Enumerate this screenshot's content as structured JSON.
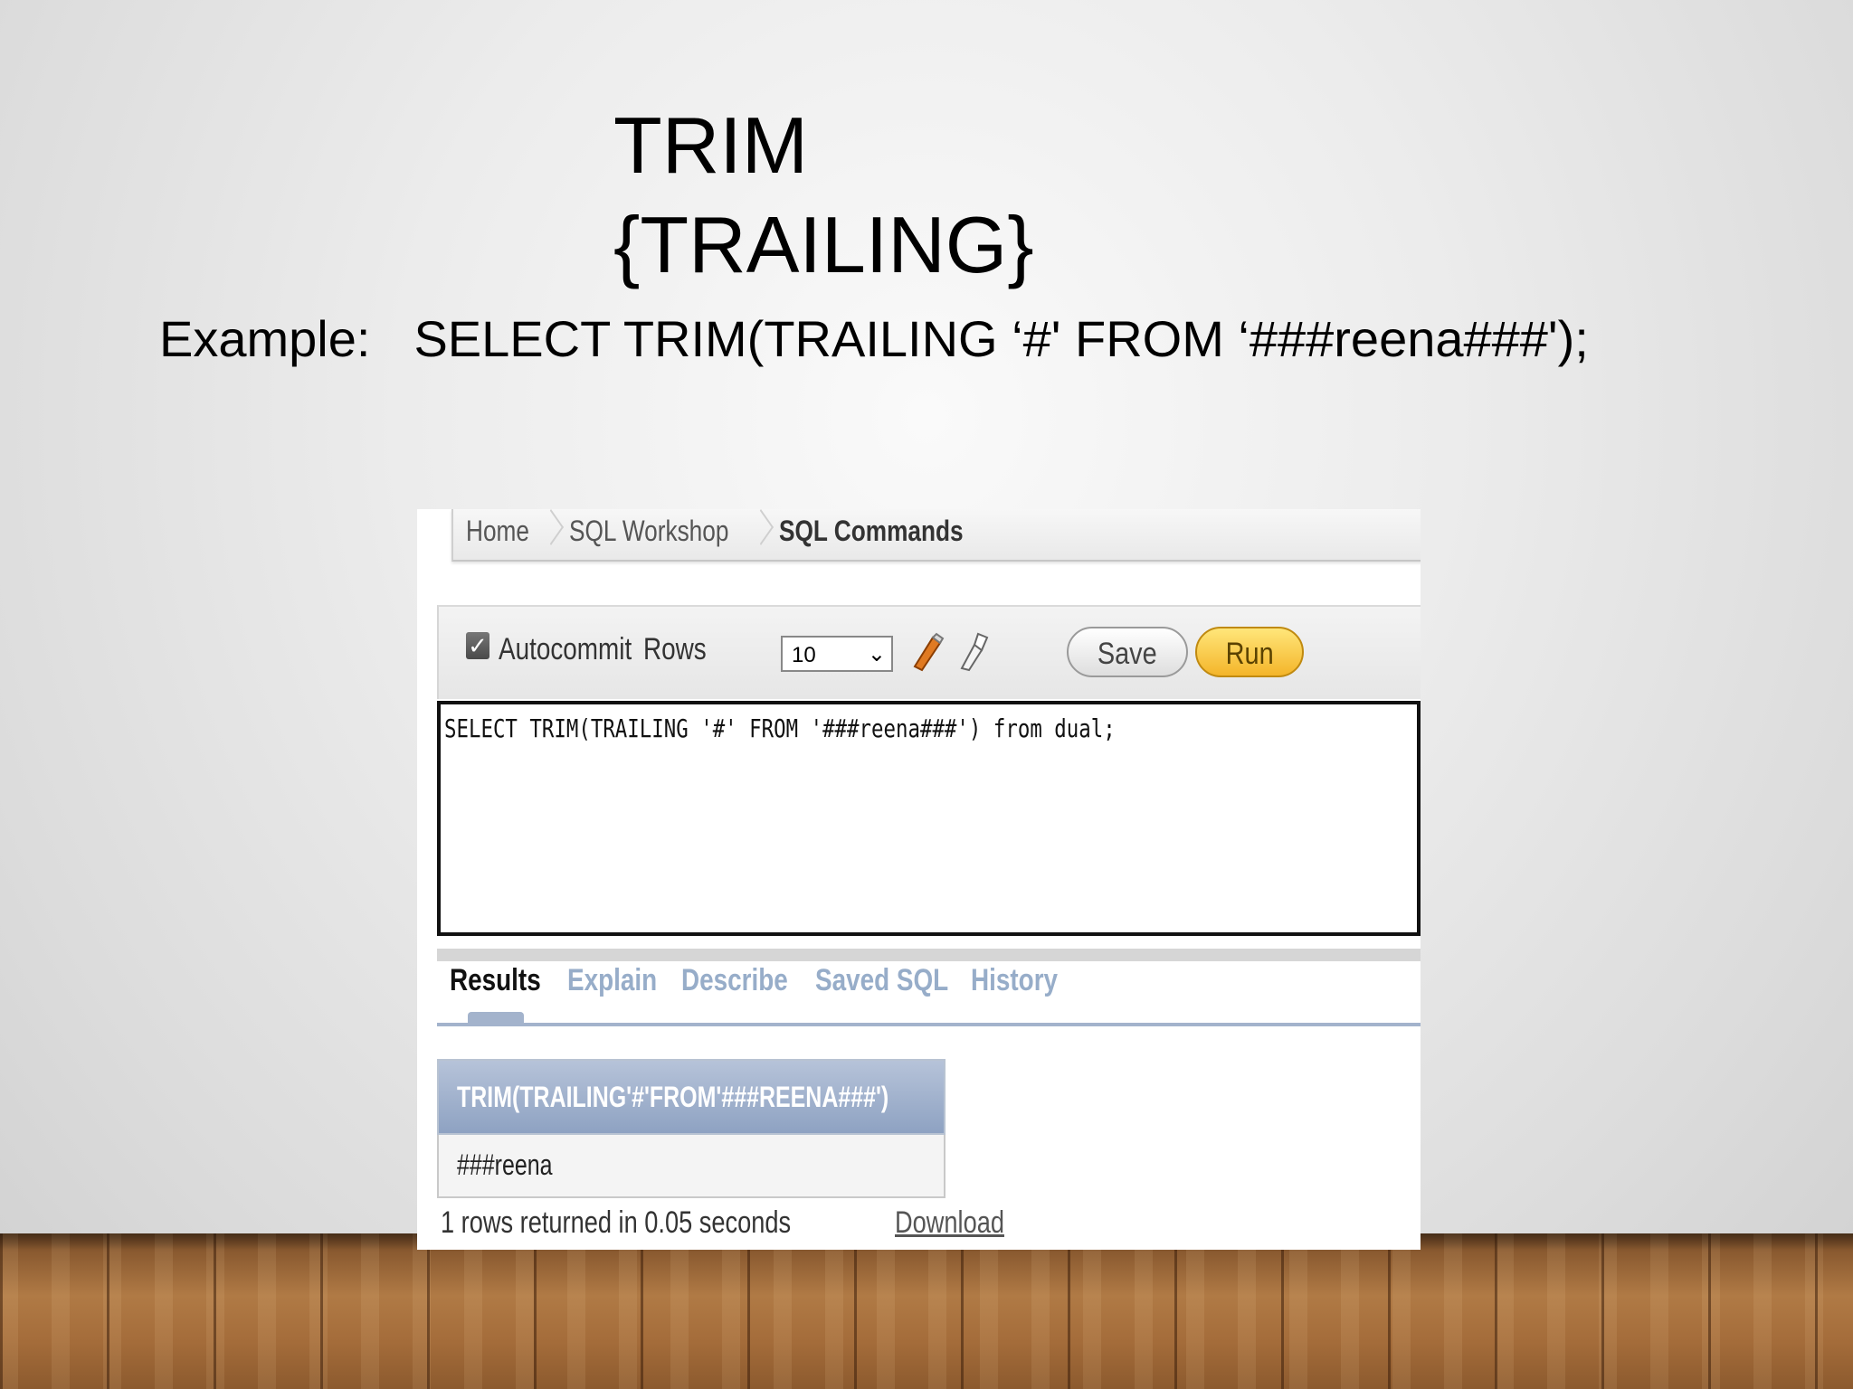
{
  "slide": {
    "title_line1": "TRIM",
    "title_line2": "{TRAILING}",
    "example_label": "Example:",
    "example_sql": "SELECT TRIM(TRAILING ‘#' FROM ‘###reena###');"
  },
  "breadcrumb": {
    "items": [
      "Home",
      "SQL Workshop",
      "SQL Commands"
    ]
  },
  "toolbar": {
    "autocommit_label": "Autocommit",
    "autocommit_checked": true,
    "rows_label": "Rows",
    "rows_value": "10",
    "clear_icon": "eraser-icon",
    "find_icon": "flashlight-icon",
    "save_label": "Save",
    "run_label": "Run"
  },
  "editor": {
    "code": "SELECT TRIM(TRAILING '#' FROM '###reena###') from dual;"
  },
  "tabs": [
    "Results",
    "Explain",
    "Describe",
    "Saved SQL",
    "History"
  ],
  "results": {
    "column_header": "TRIM(TRAILING'#'FROM'###REENA###')",
    "rows": [
      "###reena"
    ],
    "status": "1 rows returned in 0.05 seconds",
    "download_label": "Download"
  },
  "colors": {
    "run_button": "#f4b52a",
    "header_fill": "#8ea2c2",
    "inactive_tab": "#97adc9"
  }
}
